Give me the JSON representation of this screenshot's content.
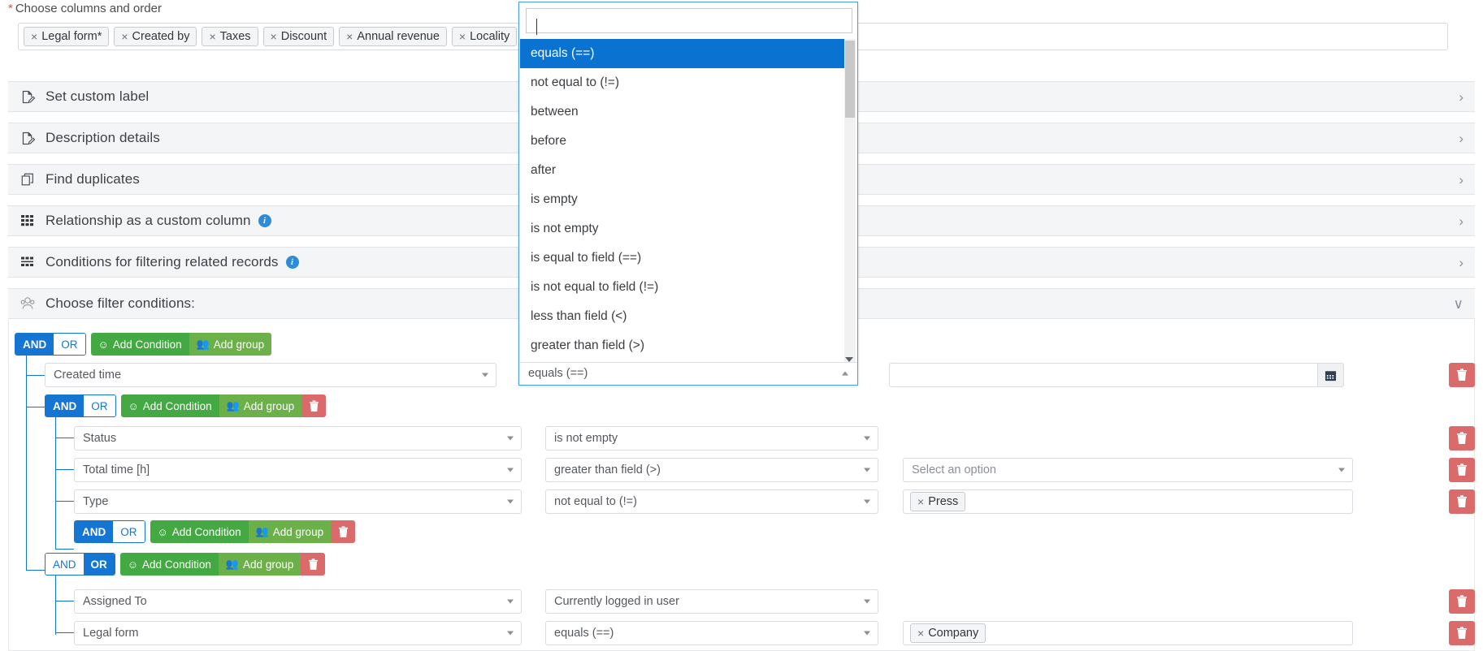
{
  "columns_chooser": {
    "label": "Choose columns and order",
    "required_marker": "*",
    "tags": [
      {
        "remove": "×",
        "label": "Legal form*"
      },
      {
        "remove": "×",
        "label": "Created by"
      },
      {
        "remove": "×",
        "label": "Taxes"
      },
      {
        "remove": "×",
        "label": "Discount"
      },
      {
        "remove": "×",
        "label": "Annual revenue"
      },
      {
        "remove": "×",
        "label": "Locality"
      }
    ]
  },
  "sections": [
    {
      "icon": "document-edit-icon",
      "title": "Set custom label",
      "chevron": "›",
      "info": false
    },
    {
      "icon": "document-edit-icon",
      "title": "Description details",
      "chevron": "›",
      "info": false
    },
    {
      "icon": "copy-icon",
      "title": "Find duplicates",
      "chevron": "›",
      "info": false
    },
    {
      "icon": "grid-icon",
      "title": "Relationship as a custom column",
      "chevron": "›",
      "info": true,
      "info_label": "i"
    },
    {
      "icon": "filter-grid-icon",
      "title": "Conditions for filtering related records",
      "chevron": "›",
      "info": true,
      "info_label": "i"
    },
    {
      "icon": "users-icon",
      "title": "Choose filter conditions:",
      "chevron": "∨",
      "info": false
    }
  ],
  "filter_builder": {
    "buttons": {
      "and": "AND",
      "or": "OR",
      "add_condition": "Add Condition",
      "add_group": "Add group",
      "delete": "🗑"
    },
    "groups": [
      {
        "id": "root",
        "active": "AND",
        "has_delete": false
      },
      {
        "id": "g1",
        "active": "AND",
        "has_delete": true
      },
      {
        "id": "g2",
        "active": "AND",
        "has_delete": true
      },
      {
        "id": "g3",
        "active": "OR",
        "has_delete": true
      }
    ],
    "conditions": [
      {
        "field": "Created time",
        "operator": "equals (==)",
        "value_type": "date",
        "value": "",
        "has_delete": true
      },
      {
        "field": "Status",
        "operator": "is not empty",
        "value_type": "none",
        "value": "",
        "has_delete": true
      },
      {
        "field": "Total time [h]",
        "operator": "greater than field (>)",
        "value_type": "select",
        "value": "Select an option",
        "has_delete": true
      },
      {
        "field": "Type",
        "operator": "not equal to (!=)",
        "value_type": "tags",
        "value": "Press",
        "has_delete": true
      },
      {
        "field": "Assigned To",
        "operator": "Currently logged in user",
        "value_type": "none",
        "value": "",
        "has_delete": true
      },
      {
        "field": "Legal form",
        "operator": "equals (==)",
        "value_type": "tags",
        "value": "Company",
        "has_delete": true
      }
    ]
  },
  "operator_dropdown": {
    "search_value": "",
    "search_placeholder": "",
    "selected": "equals (==)",
    "options": [
      "equals (==)",
      "not equal to (!=)",
      "between",
      "before",
      "after",
      "is empty",
      "is not empty",
      "is equal to field (==)",
      "is not equal to field (!=)",
      "less than field (<)",
      "greater than field (>)"
    ],
    "field_value": "equals (==)"
  },
  "colors": {
    "primary_blue": "#1476d2",
    "selected_blue": "#0a73d2",
    "green": "#44a942",
    "green_light": "#6cb04a",
    "red": "#db6a6a",
    "info_blue": "#2e8bd8"
  }
}
